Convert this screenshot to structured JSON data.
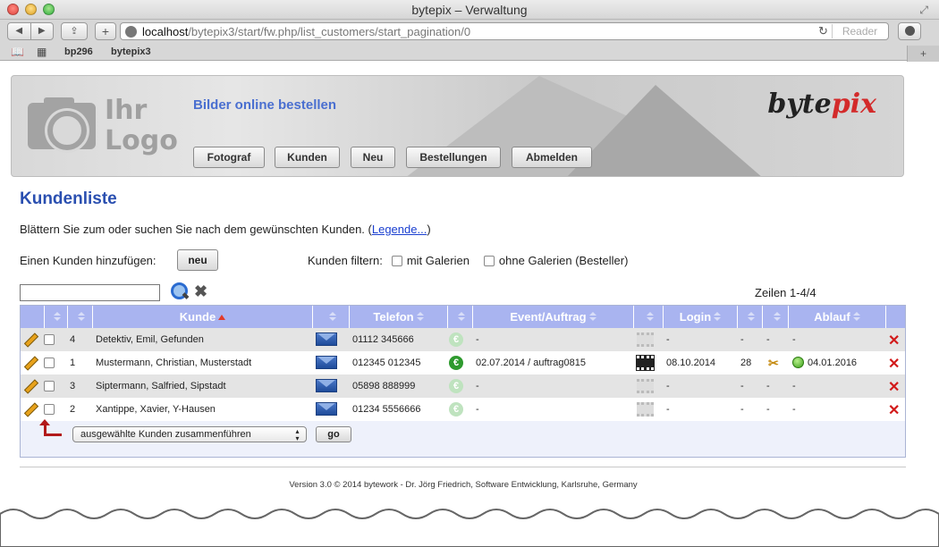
{
  "browser": {
    "window_title": "bytepix – Verwaltung",
    "url_host": "localhost",
    "url_path": "/bytepix3/start/fw.php/list_customers/start_pagination/0",
    "reader_label": "Reader",
    "bookmarks": [
      "bp296",
      "bytepix3"
    ]
  },
  "header": {
    "logo_line1": "Ihr",
    "logo_line2": "Logo",
    "tagline": "Bilder online bestellen",
    "brand_part1": "byte",
    "brand_part2": "pix",
    "nav": [
      "Fotograf",
      "Kunden",
      "Neu",
      "Bestellungen",
      "Abmelden"
    ]
  },
  "main": {
    "title": "Kundenliste",
    "intro_text": "Blättern Sie zum oder suchen Sie nach dem gewünschten Kunden. (",
    "intro_link": "Legende...",
    "intro_close": ")",
    "add_label": "Einen Kunden hinzufügen:",
    "add_button": "neu",
    "filter_label": "Kunden filtern:",
    "filter_with": "mit Galerien",
    "filter_without": "ohne Galerien (Besteller)",
    "rows_count": "Zeilen 1-4/4"
  },
  "table": {
    "columns": [
      "Kunde",
      "Telefon",
      "Event/Auftrag",
      "Login",
      "Ablauf"
    ],
    "rows": [
      {
        "num": "4",
        "kunde": "Detektiv, Emil, Gefunden",
        "telefon": "01112 345666",
        "event": "-",
        "login": "-",
        "count": "-",
        "x": "-",
        "ablauf": "-",
        "active": false
      },
      {
        "num": "1",
        "kunde": "Mustermann, Christian, Musterstadt",
        "telefon": "012345 012345",
        "event": "02.07.2014 / auftrag0815",
        "login": "08.10.2014",
        "count": "28",
        "x": "",
        "ablauf": "04.01.2016",
        "active": true
      },
      {
        "num": "3",
        "kunde": "Siptermann, Salfried, Sipstadt",
        "telefon": "05898 888999",
        "event": "-",
        "login": "-",
        "count": "-",
        "x": "-",
        "ablauf": "-",
        "active": false
      },
      {
        "num": "2",
        "kunde": "Xantippe, Xavier, Y-Hausen",
        "telefon": "01234 5556666",
        "event": "-",
        "login": "-",
        "count": "-",
        "x": "-",
        "ablauf": "-",
        "active": false
      }
    ],
    "merge_option": "ausgewählte Kunden zusammenführen",
    "go_button": "go"
  },
  "footer": {
    "text": "Version 3.0 © 2014 bytework - Dr. Jörg Friedrich, Software Entwicklung, Karlsruhe, Germany"
  },
  "icons": [
    "search-icon",
    "clear-icon",
    "edit-icon",
    "mail-icon",
    "euro-icon",
    "film-icon",
    "tools-icon",
    "status-dot-icon",
    "delete-icon",
    "merge-arrow-icon"
  ]
}
